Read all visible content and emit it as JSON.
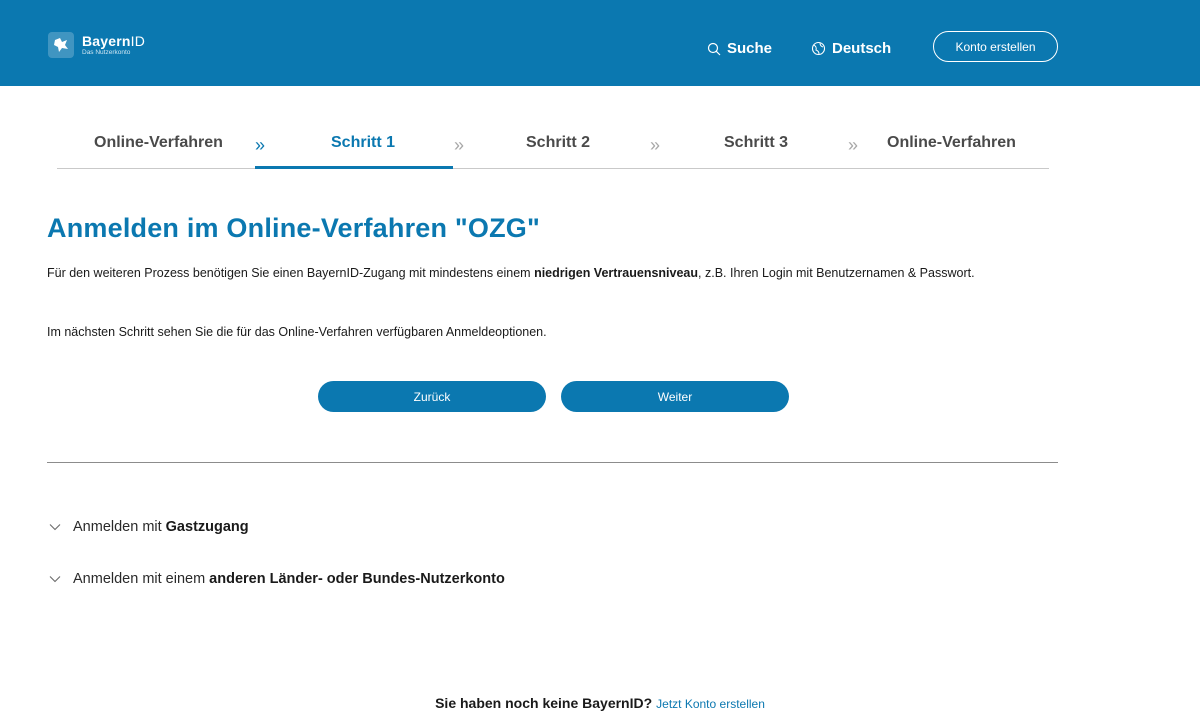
{
  "header": {
    "logo_name": "Bayern",
    "logo_name_suffix": "ID",
    "logo_subtitle": "Das Nutzerkonto",
    "search_label": "Suche",
    "language_label": "Deutsch",
    "create_account_label": "Konto erstellen",
    "background_color": "#0b78b0"
  },
  "stepper": {
    "steps": [
      {
        "label": "Online-Verfahren",
        "state": "done"
      },
      {
        "label": "Schritt 1",
        "state": "active"
      },
      {
        "label": "Schritt 2",
        "state": "upcoming"
      },
      {
        "label": "Schritt 3",
        "state": "upcoming"
      },
      {
        "label": "Online-Verfahren",
        "state": "upcoming"
      }
    ],
    "separator": "»"
  },
  "main": {
    "title": "Anmelden im Online-Verfahren \"OZG\"",
    "intro_part1": "Für den weiteren Prozess benötigen Sie einen BayernID-Zugang mit mindestens einem ",
    "intro_bold": "niedrigen Vertrauensniveau",
    "intro_part2": ", z.B. Ihren Login mit Benutzernamen & Passwort.",
    "hint": "Im nächsten Schritt sehen Sie die für das Online-Verfahren verfügbaren Anmeldeoptionen.",
    "back_button": "Zurück",
    "next_button": "Weiter"
  },
  "accordions": [
    {
      "prefix": "Anmelden mit",
      "bold": "Gastzugang"
    },
    {
      "prefix": "Anmelden mit einem",
      "bold": "anderen Länder- oder Bundes-Nutzerkonto"
    }
  ],
  "footer": {
    "question": "Sie haben noch keine BayernID?",
    "link": "Jetzt Konto erstellen"
  },
  "colors": {
    "primary": "#0b78b0",
    "text": "#1a1a1a",
    "muted_arrow": "#a8a8a8"
  }
}
